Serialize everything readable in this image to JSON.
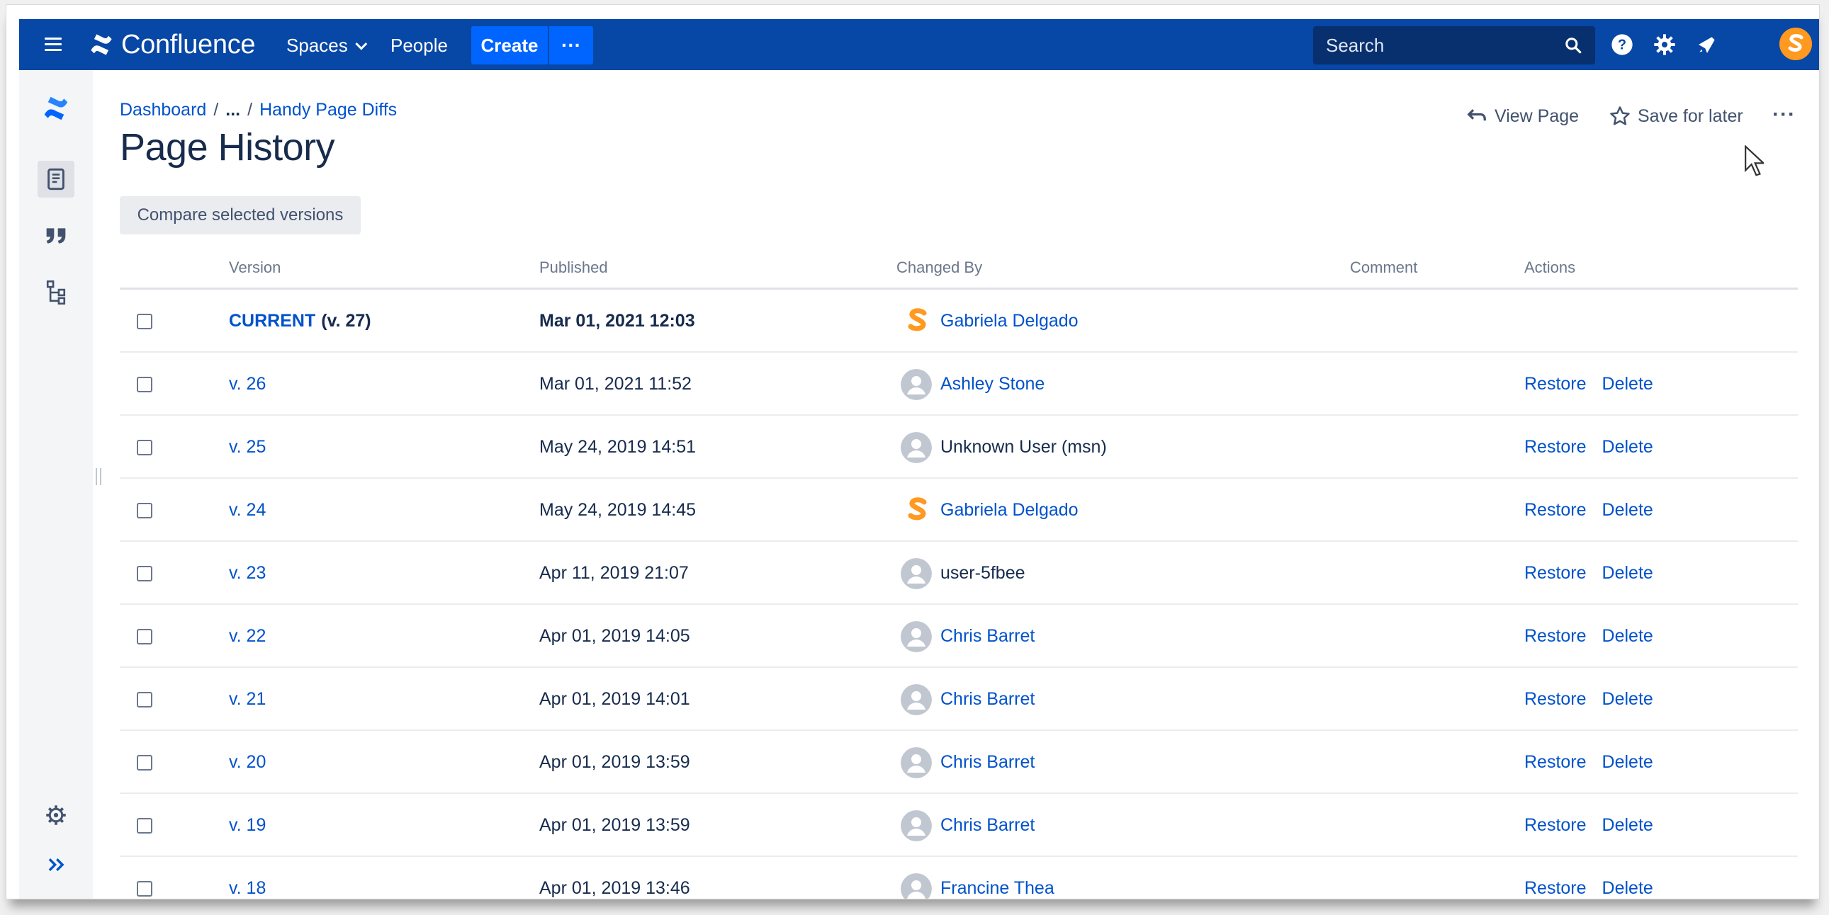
{
  "nav": {
    "brand": "Confluence",
    "spaces": "Spaces",
    "people": "People",
    "create": "Create",
    "more": "···",
    "search_placeholder": "Search",
    "accent": "#0747a6"
  },
  "breadcrumb": {
    "dashboard": "Dashboard",
    "sep": "/",
    "ellipsis": "...",
    "page": "Handy Page Diffs"
  },
  "page": {
    "title": "Page History",
    "view_page": "View Page",
    "save_for_later": "Save for later",
    "more": "···",
    "compare": "Compare selected versions"
  },
  "table": {
    "headers": {
      "version": "Version",
      "published": "Published",
      "changed_by": "Changed By",
      "comment": "Comment",
      "actions": "Actions"
    },
    "restore": "Restore",
    "delete": "Delete",
    "rows": [
      {
        "version": "CURRENT",
        "suffix": "(v. 27)",
        "published": "Mar 01, 2021 12:03",
        "user": "Gabriela Delgado",
        "avatar": "brand",
        "link": true,
        "current": true
      },
      {
        "version": "v. 26",
        "published": "Mar 01, 2021 11:52",
        "user": "Ashley Stone",
        "avatar": "default",
        "link": true
      },
      {
        "version": "v. 25",
        "published": "May 24, 2019 14:51",
        "user": "Unknown User (msn)",
        "avatar": "default",
        "link": false
      },
      {
        "version": "v. 24",
        "published": "May 24, 2019 14:45",
        "user": "Gabriela Delgado",
        "avatar": "brand",
        "link": true
      },
      {
        "version": "v. 23",
        "published": "Apr 11, 2019 21:07",
        "user": "user-5fbee",
        "avatar": "default",
        "link": false
      },
      {
        "version": "v. 22",
        "published": "Apr 01, 2019 14:05",
        "user": "Chris Barret",
        "avatar": "default",
        "link": true
      },
      {
        "version": "v. 21",
        "published": "Apr 01, 2019 14:01",
        "user": "Chris Barret",
        "avatar": "default",
        "link": true
      },
      {
        "version": "v. 20",
        "published": "Apr 01, 2019 13:59",
        "user": "Chris Barret",
        "avatar": "default",
        "link": true
      },
      {
        "version": "v. 19",
        "published": "Apr 01, 2019 13:59",
        "user": "Chris Barret",
        "avatar": "default",
        "link": true
      },
      {
        "version": "v. 18",
        "published": "Apr 01, 2019 13:46",
        "user": "Francine Thea",
        "avatar": "default",
        "link": true
      }
    ]
  }
}
